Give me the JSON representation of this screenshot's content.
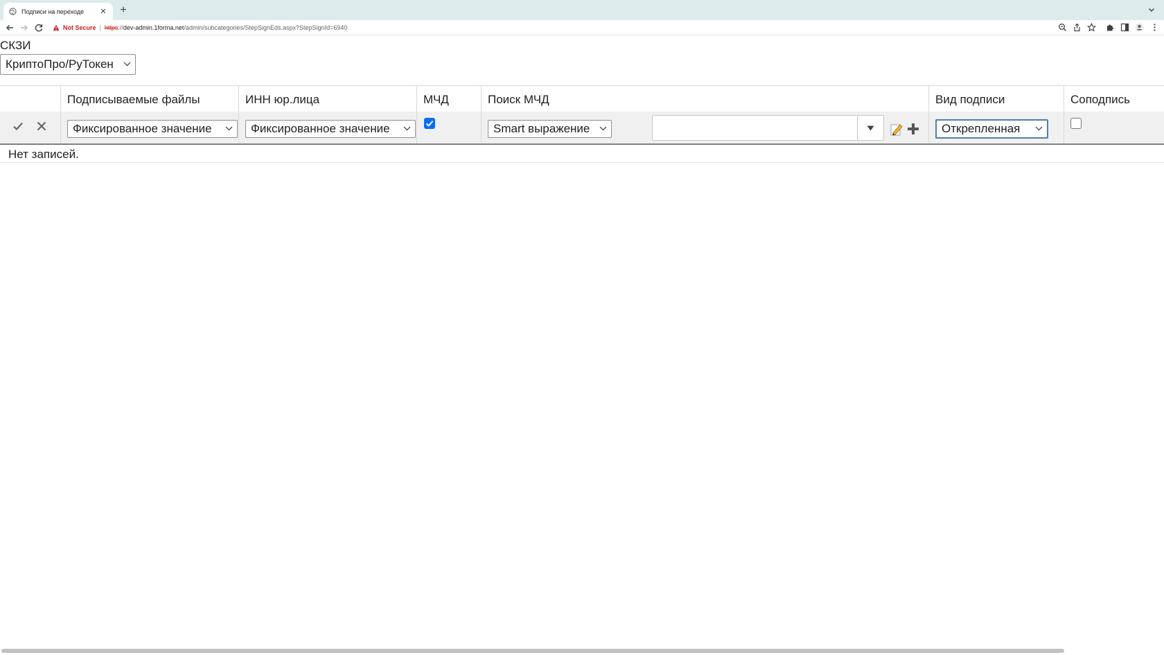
{
  "browser": {
    "tab_title": "Подписи на переходе",
    "security_label": "Not Secure",
    "url_scheme": "https",
    "url_sep": "://",
    "url_host": "dev-admin.1forma.net",
    "url_path": "/admin/subcategories/StepSignEds.aspx?StepSignId=6940"
  },
  "skzi": {
    "label": "СКЗИ",
    "selected": "КриптоПро/РуТокен"
  },
  "grid": {
    "columns": [
      "Подписываемые файлы",
      "ИНН юр.лица",
      "МЧД",
      "Поиск МЧД",
      "Вид подписи",
      "Соподпись"
    ],
    "edit_row": {
      "files_mode": "Фиксированное значение",
      "inn_mode": "Фиксированное значение",
      "mchd_checked": true,
      "search_mode": "Smart выражение",
      "search_value": "",
      "sign_type": "Открепленная",
      "cosign_checked": false
    },
    "empty_text": "Нет записей."
  },
  "colors": {
    "accent": "#0a6cf5",
    "focus_border": "#4b7fb0",
    "insecure": "#c5221f"
  }
}
